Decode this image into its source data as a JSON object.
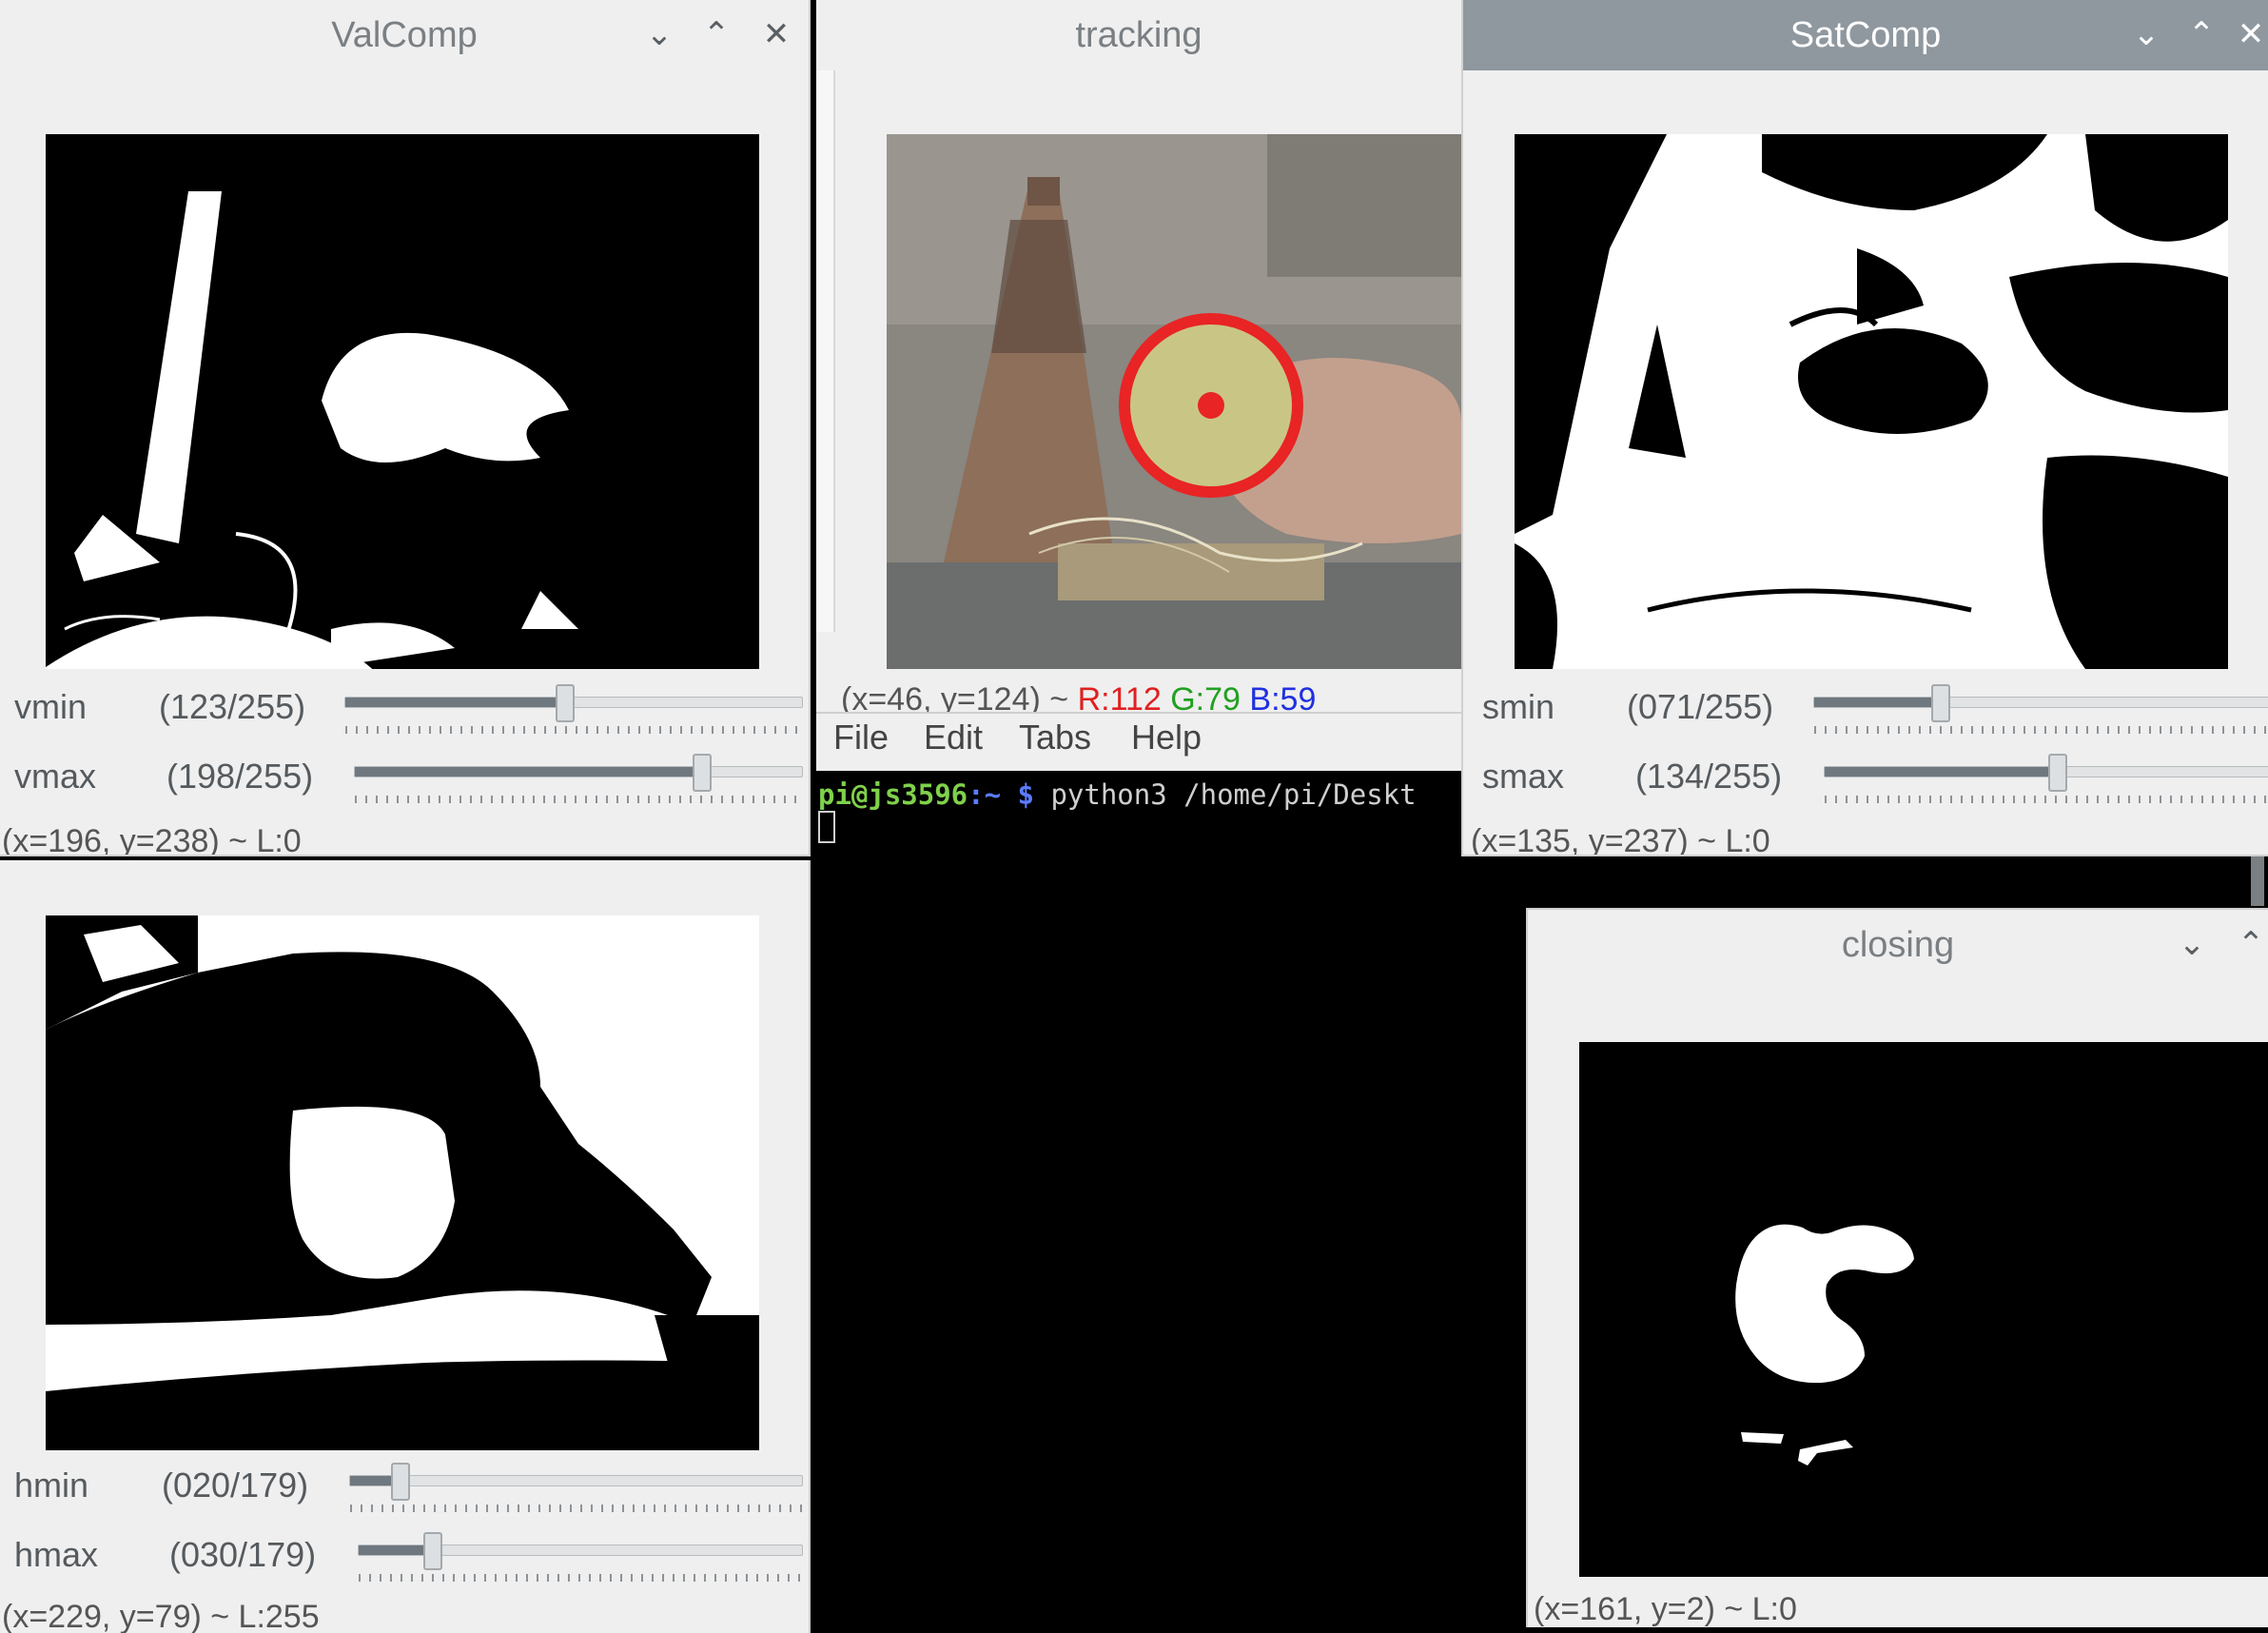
{
  "windows": {
    "valcomp": {
      "title": "ValComp",
      "sliders": [
        {
          "name": "vmin",
          "value_text": "(123/255)",
          "fraction": 0.482
        },
        {
          "name": "vmax",
          "value_text": "(198/255)",
          "fraction": 0.776
        }
      ],
      "status": "(x=196, y=238) ~ L:0"
    },
    "huecomp": {
      "sliders": [
        {
          "name": "hmin",
          "value_text": "(020/179)",
          "fraction": 0.112
        },
        {
          "name": "hmax",
          "value_text": "(030/179)",
          "fraction": 0.168
        }
      ],
      "status": "(x=229, y=79) ~ L:255"
    },
    "tracking": {
      "title": "tracking",
      "status_coords": "(x=46, y=124) ~",
      "status_r": "R:112",
      "status_g": "G:79",
      "status_b": "B:59"
    },
    "satcomp": {
      "title": "SatComp",
      "sliders": [
        {
          "name": "smin",
          "value_text": "(071/255)",
          "fraction": 0.278
        },
        {
          "name": "smax",
          "value_text": "(134/255)",
          "fraction": 0.525
        }
      ],
      "status": "(x=135, y=237) ~ L:0"
    },
    "closing": {
      "title": "closing",
      "status": "(x=161, y=2) ~ L:0"
    }
  },
  "terminal": {
    "menu": [
      "File",
      "Edit",
      "Tabs",
      "Help"
    ],
    "prompt_user": "pi@js3596",
    "prompt_path": ":~",
    "prompt_symbol": "$",
    "command": "python3 /home/pi/Deskt"
  },
  "colors": {
    "status_r": "#e02020",
    "status_g": "#22a022",
    "status_b": "#2030e0",
    "prompt_user": "#7fd14a",
    "prompt_symbol": "#5b7cff",
    "active_titlebar": "#8f989f"
  },
  "icons": {
    "minimize": "chevron-down-icon",
    "maximize": "chevron-up-icon",
    "close": "close-icon"
  }
}
